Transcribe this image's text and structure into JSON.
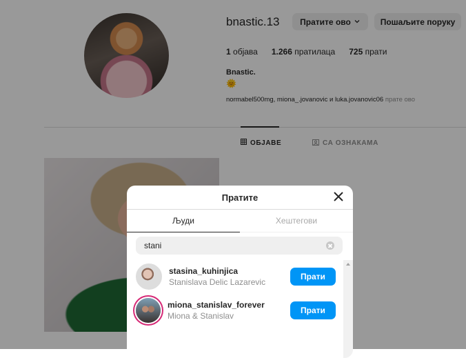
{
  "profile": {
    "username": "bnastic.13",
    "follow_dropdown_label": "Пратите ово",
    "message_label": "Пошаљите поруку",
    "posts_count": "1",
    "posts_label": "објава",
    "followers_count": "1.266",
    "followers_label": "пратилаца",
    "following_count": "725",
    "following_label": "прати",
    "full_name": "Bnastic.",
    "bio_emoji": "🌞",
    "followed_by_names": "normabel500mg, miona_.jovanovic",
    "followed_by_and": "и",
    "followed_by_last": "luka.jovanovic06",
    "followed_by_suffix": "прате ово"
  },
  "tabs": {
    "posts": "ОБЈАВЕ",
    "tagged": "СА ОЗНАКАМА"
  },
  "modal": {
    "title": "Пратите",
    "tab_people": "Људи",
    "tab_hashtags": "Хештегови",
    "search_value": "stani",
    "results": [
      {
        "username": "stasina_kuhinjica",
        "name": "Stanislava Delic Lazarevic",
        "button": "Прати"
      },
      {
        "username": "miona_stanislav_forever",
        "name": "Miona & Stanislav",
        "button": "Прати"
      }
    ]
  },
  "colors": {
    "accent": "#0095f6",
    "overlay": "rgba(0,0,0,0.4)"
  },
  "icons": {
    "close": "close-icon",
    "clear": "clear-search-icon",
    "grid": "grid-icon",
    "tag": "tag-icon",
    "chevron": "chevron-down-icon"
  }
}
